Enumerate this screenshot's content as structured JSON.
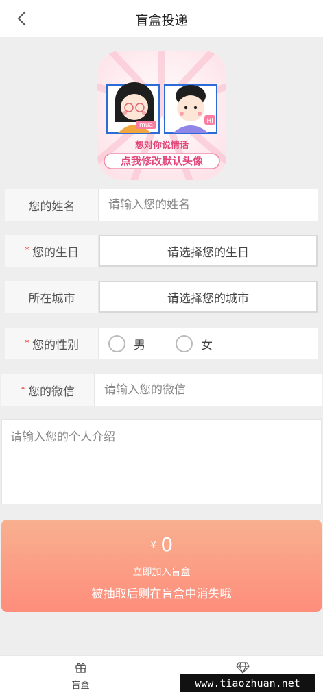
{
  "header": {
    "title": "盲盒投递"
  },
  "avatar": {
    "slogan_top": "想对你说情话",
    "slogan_bottom": "点我修改默认头像",
    "tag_left": "mua",
    "tag_right": "Hi"
  },
  "form": {
    "name": {
      "label": "您的姓名",
      "placeholder": "请输入您的姓名"
    },
    "birthday": {
      "required_mark": "*",
      "label": "您的生日",
      "value": "请选择您的生日"
    },
    "city": {
      "label": "所在城市",
      "value": "请选择您的城市"
    },
    "gender": {
      "required_mark": "*",
      "label": "您的性别",
      "options": [
        "男",
        "女"
      ]
    },
    "wechat": {
      "required_mark": "*",
      "label": "您的微信",
      "placeholder": "请输入您的微信"
    },
    "intro": {
      "placeholder": "请输入您的个人介绍"
    }
  },
  "cta": {
    "currency": "¥",
    "amount": "0",
    "join_label": "立即加入盲盒",
    "desc": "被抽取后则在盲盒中消失哦"
  },
  "tabbar": {
    "items": [
      {
        "label": "盲盒",
        "icon": "gift-icon"
      },
      {
        "label": "",
        "icon": "diamond-icon"
      }
    ]
  },
  "watermark": "www.tiaozhuan.net",
  "colors": {
    "accent": "#fe8d7c",
    "accent_light": "#f8b08f",
    "required": "#e33333"
  }
}
